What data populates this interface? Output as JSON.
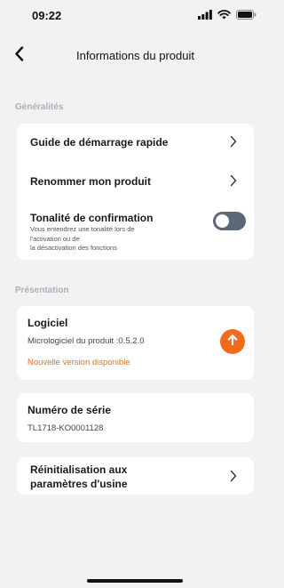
{
  "status": {
    "time": "09:22"
  },
  "nav": {
    "title": "Informations du produit"
  },
  "general": {
    "header": "Généralités",
    "quick_start": "Guide de démarrage rapide",
    "rename": "Renommer mon produit",
    "confirmation_tone": {
      "label": "Tonalité de confirmation",
      "description": "Vous entendrez une tonalité lors de\nl'activation ou de\n la désactivation des fonctions",
      "enabled": false
    }
  },
  "presentation": {
    "header": "Présentation",
    "software": {
      "label": "Logiciel",
      "firmware": "Micrologiciel du produit :0.5.2.0",
      "update_notice": "Nouvelle version disponible"
    },
    "serial": {
      "label": "Numéro de série",
      "value": "TL1718-KO0001128"
    },
    "factory_reset": "Réinitialisation aux\nparamètres d'usine"
  },
  "colors": {
    "accent": "#f26b1d",
    "section_header": "#a9b1ba",
    "toggle_off": "#5c6777",
    "background": "#f2f2f2"
  }
}
